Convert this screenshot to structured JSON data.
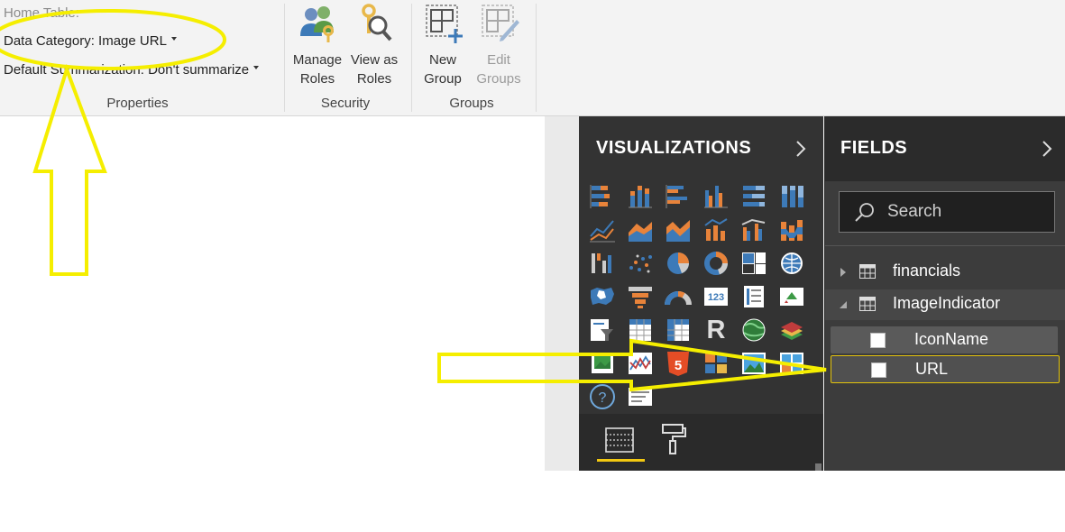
{
  "ribbon": {
    "properties": {
      "home_table": "Home Table:",
      "data_category": "Data Category: Image URL",
      "default_summarization": "Default Summarization: Don't summarize",
      "group_label": "Properties"
    },
    "security": {
      "manage_roles_line1": "Manage",
      "manage_roles_line2": "Roles",
      "view_as_roles_line1": "View as",
      "view_as_roles_line2": "Roles",
      "group_label": "Security"
    },
    "groups": {
      "new_group_line1": "New",
      "new_group_line2": "Group",
      "edit_groups_line1": "Edit",
      "edit_groups_line2": "Groups",
      "group_label": "Groups"
    }
  },
  "visualizations": {
    "title": "VISUALIZATIONS",
    "r_label": "R"
  },
  "fields": {
    "title": "FIELDS",
    "search_placeholder": "Search",
    "tables": [
      {
        "name": "financials",
        "expanded": false
      },
      {
        "name": "ImageIndicator",
        "expanded": true,
        "fields": [
          "IconName",
          "URL"
        ]
      }
    ]
  },
  "colors": {
    "annotation": "#f5ee00",
    "accent": "#f2c811",
    "orange": "#e8833a",
    "blue": "#3d7ab8"
  }
}
